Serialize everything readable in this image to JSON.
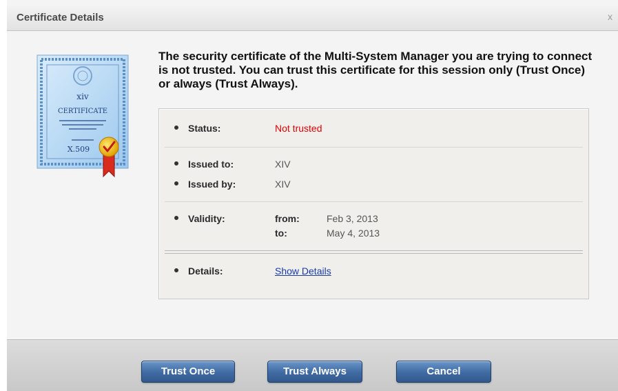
{
  "dialog": {
    "title": "Certificate Details",
    "close_label": "x"
  },
  "certificate_icon": {
    "line1": "xiv",
    "line2": "CERTIFICATE",
    "line3": "X.509"
  },
  "message": "The security certificate of the Multi-System Manager you are trying to connect is not trusted. You can trust this certificate for this session only (Trust Once) or always (Trust Always).",
  "info": {
    "status_label": "Status:",
    "status_value": "Not trusted",
    "issued_to_label": "Issued to:",
    "issued_to_value": "XIV",
    "issued_by_label": "Issued by:",
    "issued_by_value": "XIV",
    "validity_label": "Validity:",
    "from_label": "from:",
    "from_value": "Feb 3, 2013",
    "to_label": "to:",
    "to_value": "May 4, 2013",
    "details_label": "Details:",
    "details_link": "Show Details"
  },
  "buttons": {
    "trust_once": "Trust Once",
    "trust_always": "Trust Always",
    "cancel": "Cancel"
  },
  "colors": {
    "status_not_trusted": "#e00000",
    "button_blue": "#3f6aa2",
    "link_blue": "#1a3aa8"
  }
}
